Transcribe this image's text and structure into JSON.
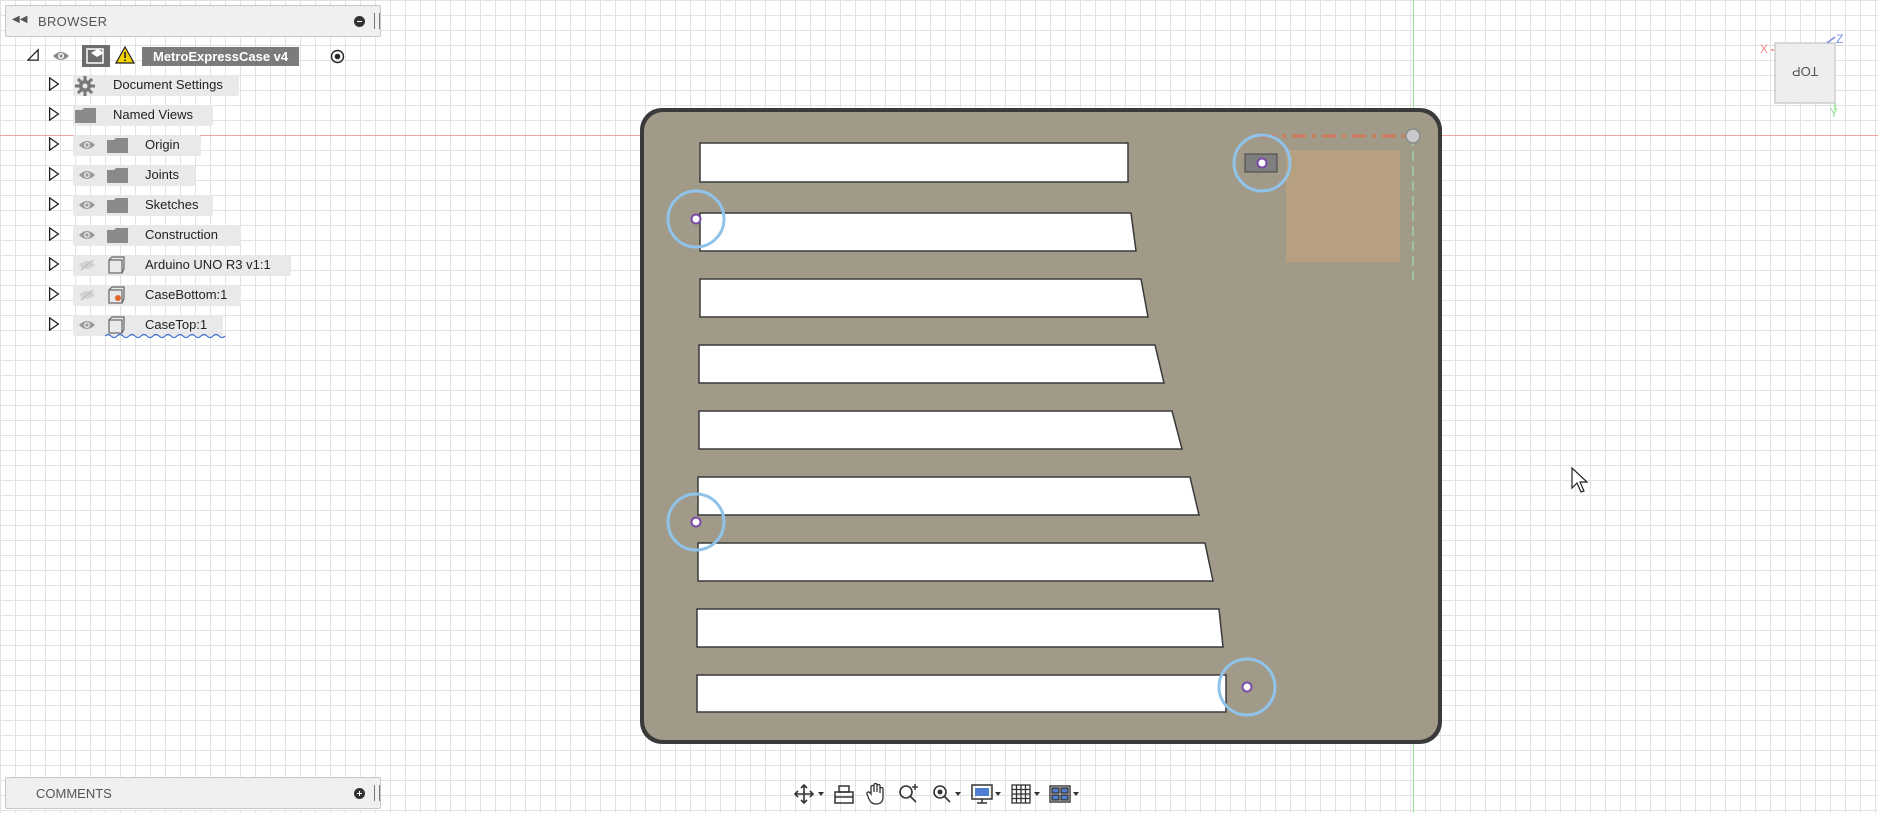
{
  "browser": {
    "title": "BROWSER",
    "root": {
      "label": "MetroExpressCase v4"
    },
    "items": [
      {
        "label": "Document Settings",
        "icon": "gear-icon"
      },
      {
        "label": "Named Views",
        "icon": "folder-icon"
      },
      {
        "label": "Origin",
        "icon": "folder-icon",
        "visible": true
      },
      {
        "label": "Joints",
        "icon": "folder-icon",
        "visible": true
      },
      {
        "label": "Sketches",
        "icon": "folder-icon",
        "visible": true
      },
      {
        "label": "Construction",
        "icon": "folder-icon",
        "visible": true
      },
      {
        "label": "Arduino UNO R3 v1:1",
        "icon": "component-icon",
        "visible": false
      },
      {
        "label": "CaseBottom:1",
        "icon": "component-icon",
        "visible": false
      },
      {
        "label": "CaseTop:1",
        "icon": "component-icon",
        "visible": true
      }
    ]
  },
  "comments": {
    "title": "COMMENTS"
  },
  "view_cube": {
    "face_label": "TOP",
    "x_label": "X",
    "y_label": "Y",
    "z_label": "Z"
  },
  "colors": {
    "plate": "#a29a88",
    "plate_edge": "#3a3a3a",
    "selection_ring": "#8fc3ea",
    "warning": "#f5d200",
    "board_highlight": "#c7a57a"
  },
  "toolbar": {
    "tools": [
      "orbit-icon",
      "look-at-icon",
      "pan-icon",
      "zoom-icon",
      "fit-icon",
      "display-settings-icon",
      "grid-icon",
      "viewports-icon"
    ]
  }
}
